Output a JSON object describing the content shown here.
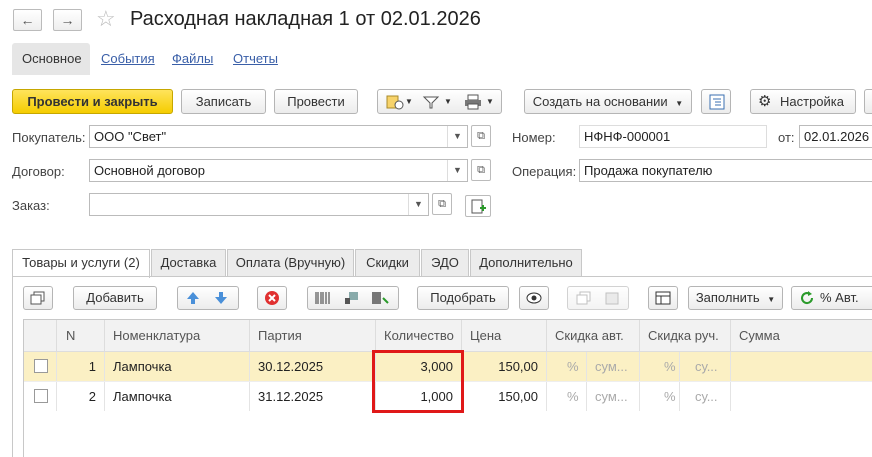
{
  "header": {
    "title": "Расходная накладная 1 от 02.01.2026",
    "back_glyph": "←",
    "forward_glyph": "→",
    "star_glyph": "☆"
  },
  "section_tabs": [
    "Основное",
    "События",
    "Файлы",
    "Отчеты"
  ],
  "toolbar": {
    "post_and_close": "Провести и закрыть",
    "save": "Записать",
    "post": "Провести",
    "create_based": "Создать на основании",
    "settings": "Настройка"
  },
  "form": {
    "buyer_label": "Покупатель:",
    "buyer_value": "ООО \"Свет\"",
    "contract_label": "Договор:",
    "contract_value": "Основной договор",
    "order_label": "Заказ:",
    "order_value": "",
    "number_label": "Номер:",
    "number_value": "НФНФ-000001",
    "date_label": "от:",
    "date_value": "02.01.2026",
    "operation_label": "Операция:",
    "operation_value": "Продажа покупателю"
  },
  "form_tabs": [
    "Товары и услуги (2)",
    "Доставка",
    "Оплата (Вручную)",
    "Скидки",
    "ЭДО",
    "Дополнительно"
  ],
  "table_toolbar": {
    "add": "Добавить",
    "select": "Подобрать",
    "fill": "Заполнить",
    "auto_percent": "% Авт."
  },
  "table": {
    "columns": [
      "N",
      "Номенклатура",
      "Партия",
      "Количество",
      "Цена",
      "Скидка авт.",
      "Скидка руч.",
      "Сумма"
    ],
    "rows": [
      {
        "n": "1",
        "item": "Лампочка",
        "batch": "30.12.2025",
        "qty": "3,000",
        "price": "150,00",
        "auto_pct": "%",
        "auto_sum": "сум...",
        "man_pct": "%",
        "man_sum": "су...",
        "sum": ""
      },
      {
        "n": "2",
        "item": "Лампочка",
        "batch": "31.12.2025",
        "qty": "1,000",
        "price": "150,00",
        "auto_pct": "%",
        "auto_sum": "сум...",
        "man_pct": "%",
        "man_sum": "су...",
        "sum": ""
      }
    ]
  },
  "colors": {
    "primary_button": "#f5cd00",
    "selected_row": "#fbf0c4",
    "highlight_border": "#e01818",
    "link": "#3a5fa8"
  }
}
